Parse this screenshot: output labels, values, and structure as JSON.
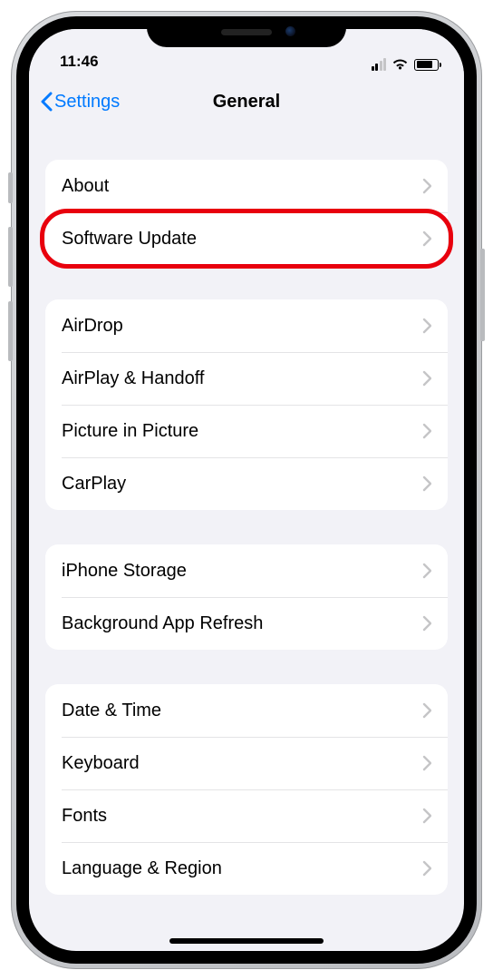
{
  "status": {
    "time": "11:46"
  },
  "nav": {
    "back_label": "Settings",
    "title": "General"
  },
  "groups": [
    {
      "rows": [
        "About",
        "Software Update"
      ]
    },
    {
      "rows": [
        "AirDrop",
        "AirPlay & Handoff",
        "Picture in Picture",
        "CarPlay"
      ]
    },
    {
      "rows": [
        "iPhone Storage",
        "Background App Refresh"
      ]
    },
    {
      "rows": [
        "Date & Time",
        "Keyboard",
        "Fonts",
        "Language & Region"
      ]
    }
  ],
  "highlight": {
    "group": 0,
    "row": 1
  }
}
